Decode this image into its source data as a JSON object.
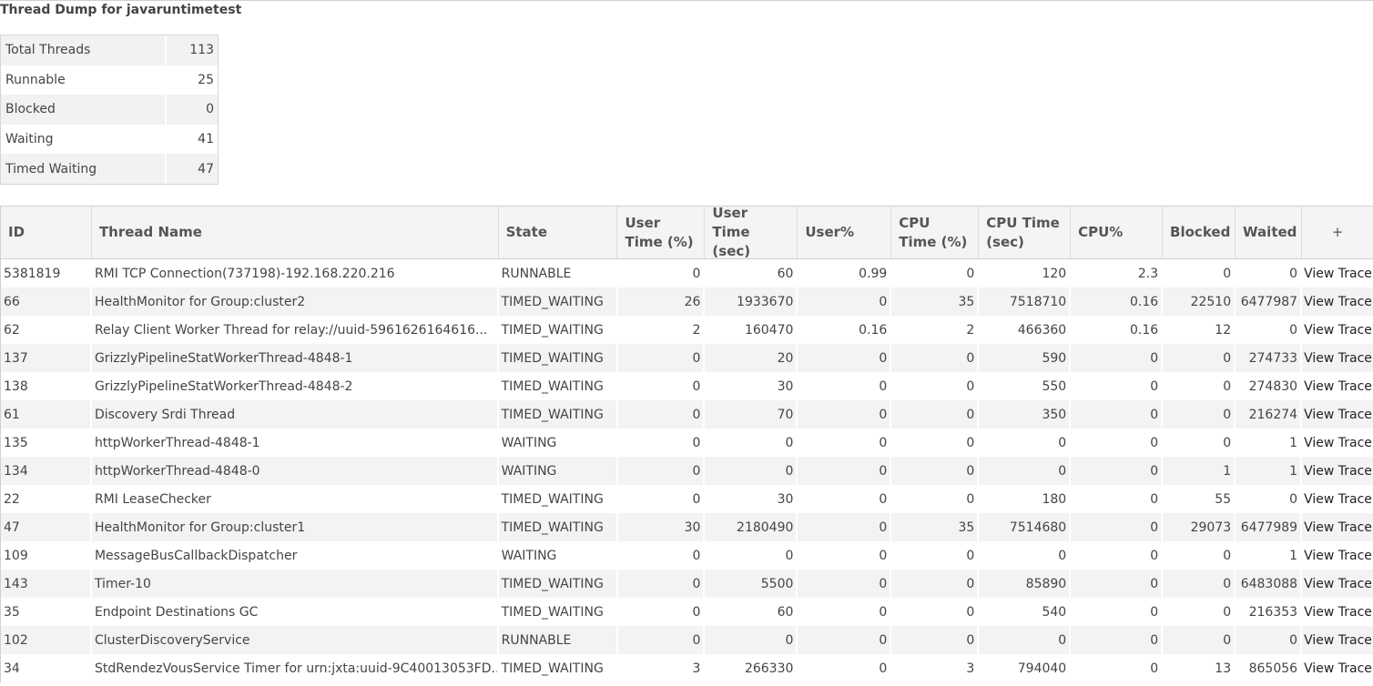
{
  "page": {
    "title": "Thread Dump for javaruntimetest"
  },
  "summary": [
    {
      "label": "Total Threads",
      "value": "113"
    },
    {
      "label": "Runnable",
      "value": "25"
    },
    {
      "label": "Blocked",
      "value": "0"
    },
    {
      "label": "Waiting",
      "value": "41"
    },
    {
      "label": "Timed Waiting",
      "value": "47"
    }
  ],
  "threads": {
    "headers": {
      "id": "ID",
      "name": "Thread Name",
      "state": "State",
      "user_time_pct": "User Time (%)",
      "user_time_sec": "User Time (sec)",
      "user_pct": "User%",
      "cpu_time_pct": "CPU Time (%)",
      "cpu_time_sec": "CPU Time (sec)",
      "cpu_pct": "CPU%",
      "blocked": "Blocked",
      "waited": "Waited",
      "add": "+"
    },
    "rows": [
      {
        "id": "5381819",
        "name": "RMI TCP Connection(737198)-192.168.220.216",
        "state": "RUNNABLE",
        "ut": "0",
        "uts": "60",
        "up": "0.99",
        "ct": "0",
        "cts": "120",
        "cp": "2.3",
        "bl": "0",
        "wa": "0",
        "action": "View Trace"
      },
      {
        "id": "66",
        "name": "HealthMonitor for Group:cluster2",
        "state": "TIMED_WAITING",
        "ut": "26",
        "uts": "1933670",
        "up": "0",
        "ct": "35",
        "cts": "7518710",
        "cp": "0.16",
        "bl": "22510",
        "wa": "6477987",
        "action": "View Trace"
      },
      {
        "id": "62",
        "name": "Relay Client Worker Thread for relay://uuid-5961626164616...",
        "state": "TIMED_WAITING",
        "ut": "2",
        "uts": "160470",
        "up": "0.16",
        "ct": "2",
        "cts": "466360",
        "cp": "0.16",
        "bl": "12",
        "wa": "0",
        "action": "View Trace"
      },
      {
        "id": "137",
        "name": "GrizzlyPipelineStatWorkerThread-4848-1",
        "state": "TIMED_WAITING",
        "ut": "0",
        "uts": "20",
        "up": "0",
        "ct": "0",
        "cts": "590",
        "cp": "0",
        "bl": "0",
        "wa": "274733",
        "action": "View Trace"
      },
      {
        "id": "138",
        "name": "GrizzlyPipelineStatWorkerThread-4848-2",
        "state": "TIMED_WAITING",
        "ut": "0",
        "uts": "30",
        "up": "0",
        "ct": "0",
        "cts": "550",
        "cp": "0",
        "bl": "0",
        "wa": "274830",
        "action": "View Trace"
      },
      {
        "id": "61",
        "name": "Discovery Srdi Thread",
        "state": "TIMED_WAITING",
        "ut": "0",
        "uts": "70",
        "up": "0",
        "ct": "0",
        "cts": "350",
        "cp": "0",
        "bl": "0",
        "wa": "216274",
        "action": "View Trace"
      },
      {
        "id": "135",
        "name": "httpWorkerThread-4848-1",
        "state": "WAITING",
        "ut": "0",
        "uts": "0",
        "up": "0",
        "ct": "0",
        "cts": "0",
        "cp": "0",
        "bl": "0",
        "wa": "1",
        "action": "View Trace"
      },
      {
        "id": "134",
        "name": "httpWorkerThread-4848-0",
        "state": "WAITING",
        "ut": "0",
        "uts": "0",
        "up": "0",
        "ct": "0",
        "cts": "0",
        "cp": "0",
        "bl": "1",
        "wa": "1",
        "action": "View Trace"
      },
      {
        "id": "22",
        "name": "RMI LeaseChecker",
        "state": "TIMED_WAITING",
        "ut": "0",
        "uts": "30",
        "up": "0",
        "ct": "0",
        "cts": "180",
        "cp": "0",
        "bl": "55",
        "wa": "0",
        "action": "View Trace"
      },
      {
        "id": "47",
        "name": "HealthMonitor for Group:cluster1",
        "state": "TIMED_WAITING",
        "ut": "30",
        "uts": "2180490",
        "up": "0",
        "ct": "35",
        "cts": "7514680",
        "cp": "0",
        "bl": "29073",
        "wa": "6477989",
        "action": "View Trace"
      },
      {
        "id": "109",
        "name": "MessageBusCallbackDispatcher",
        "state": "WAITING",
        "ut": "0",
        "uts": "0",
        "up": "0",
        "ct": "0",
        "cts": "0",
        "cp": "0",
        "bl": "0",
        "wa": "1",
        "action": "View Trace"
      },
      {
        "id": "143",
        "name": "Timer-10",
        "state": "TIMED_WAITING",
        "ut": "0",
        "uts": "5500",
        "up": "0",
        "ct": "0",
        "cts": "85890",
        "cp": "0",
        "bl": "0",
        "wa": "6483088",
        "action": "View Trace"
      },
      {
        "id": "35",
        "name": "Endpoint Destinations GC",
        "state": "TIMED_WAITING",
        "ut": "0",
        "uts": "60",
        "up": "0",
        "ct": "0",
        "cts": "540",
        "cp": "0",
        "bl": "0",
        "wa": "216353",
        "action": "View Trace"
      },
      {
        "id": "102",
        "name": "ClusterDiscoveryService",
        "state": "RUNNABLE",
        "ut": "0",
        "uts": "0",
        "up": "0",
        "ct": "0",
        "cts": "0",
        "cp": "0",
        "bl": "0",
        "wa": "0",
        "action": "View Trace"
      },
      {
        "id": "34",
        "name": "StdRendezVousService Timer for urn:jxta:uuid-9C40013053FD...",
        "state": "TIMED_WAITING",
        "ut": "3",
        "uts": "266330",
        "up": "0",
        "ct": "3",
        "cts": "794040",
        "cp": "0",
        "bl": "13",
        "wa": "865056",
        "action": "View Trace"
      }
    ]
  }
}
